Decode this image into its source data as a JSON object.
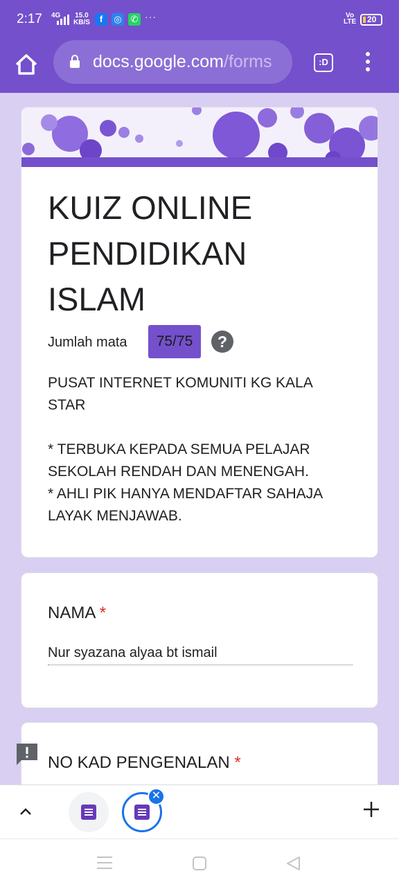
{
  "status_bar": {
    "time": "2:17",
    "network": "4G",
    "speed_value": "15.0",
    "speed_unit": "KB/S",
    "more": "···",
    "volte_top": "Vo",
    "volte_bottom": "LTE",
    "battery": "20",
    "app_icons": [
      "facebook-icon",
      "messenger-icon",
      "whatsapp-icon"
    ]
  },
  "browser": {
    "url_host": "docs.google.com",
    "url_path": "/forms",
    "tab_count_label": ":D"
  },
  "form": {
    "title": "KUIZ ONLINE PENDIDIKAN ISLAM",
    "score_label": "Jumlah mata",
    "score_value": "75/75",
    "help_symbol": "?",
    "description": "PUSAT INTERNET KOMUNITI KG KALA STAR\n\n* TERBUKA KEPADA SEMUA PELAJAR SEKOLAH RENDAH DAN MENENGAH.\n* AHLI PIK HANYA MENDAFTAR SAHAJA LAYAK MENJAWAB.",
    "accent_color": "#7450cc"
  },
  "questions": [
    {
      "title": "NAMA",
      "required_mark": "*",
      "answer": "Nur syazana alyaa bt ismail"
    },
    {
      "title": "NO KAD PENGENALAN",
      "required_mark": "*"
    }
  ],
  "tab_switcher": {
    "close_symbol": "✕"
  }
}
